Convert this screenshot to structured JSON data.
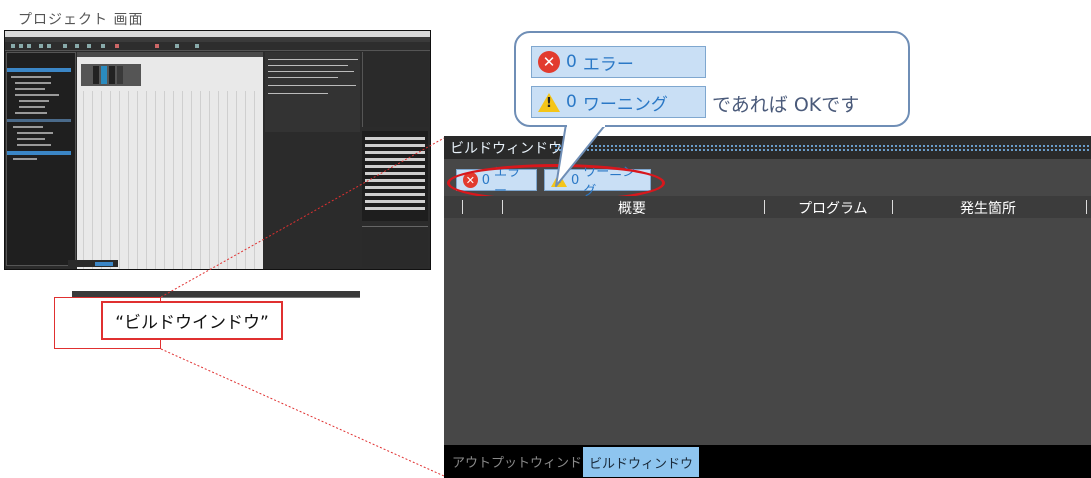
{
  "caption": "プロジェクト 画面",
  "thumb_label": "“ビルドウインドウ”",
  "build_window": {
    "title": "ビルドウィンドウ",
    "errors": {
      "count": "0",
      "label": "エラー"
    },
    "warnings": {
      "count": "0",
      "label": "ワーニング"
    },
    "columns": [
      "概要",
      "プログラム",
      "発生箇所"
    ],
    "tabs": {
      "output": "アウトプットウィンドウ",
      "build": "ビルドウィンドウ"
    }
  },
  "callout": {
    "error_count": "0",
    "error_label": "エラー",
    "warning_count": "0",
    "warning_label": "ワーニング",
    "suffix": "であれば OKです"
  },
  "colors": {
    "error_red": "#e23b2e",
    "warning_yellow": "#f5c518",
    "highlight_red": "#d8171c",
    "badge_bg": "#c9dff5",
    "badge_text": "#2a78c6",
    "tab_active": "#8ec5ef"
  },
  "icons": [
    "error-x-icon",
    "warning-triangle-icon"
  ]
}
